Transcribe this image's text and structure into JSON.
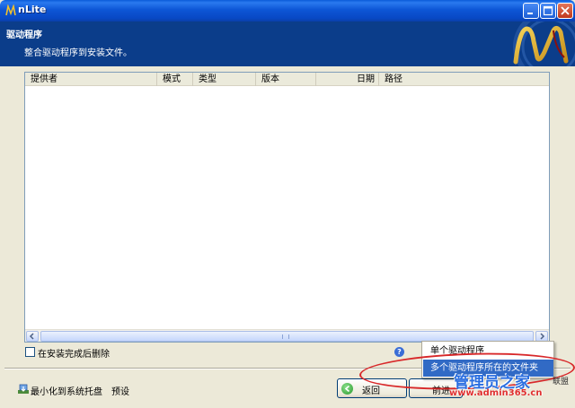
{
  "window": {
    "title": "nLite",
    "minimize_icon": "minimize-icon",
    "maximize_icon": "maximize-icon",
    "close_icon": "close-icon"
  },
  "header": {
    "title": "驱动程序",
    "subtitle": "整合驱动程序到安装文件。",
    "logo_icon": "nlite-logo-icon"
  },
  "driver_list": {
    "columns": [
      "提供者",
      "模式",
      "类型",
      "版本",
      "日期",
      "路径"
    ],
    "rows": []
  },
  "options": {
    "delete_after_install_label": "在安装完成后删除",
    "delete_after_install_checked": false
  },
  "footer": {
    "minimize_to_tray_label": "最小化到系统托盘",
    "preset_label": "预设",
    "back_label": "返回",
    "next_label": "前进"
  },
  "insert_menu": {
    "items": [
      "单个驱动程序",
      "多个驱动程序所在的文件夹"
    ],
    "selected": "多个驱动程序所在的文件夹"
  },
  "watermark": {
    "title": "管理员之家",
    "url": "www.admin365.cn",
    "union": "联盟"
  },
  "colors": {
    "titlebar": "#0a5bd8",
    "header_bg": "#0b3d8a",
    "menu_highlight": "#316ac5",
    "annotation": "#d8282a"
  }
}
